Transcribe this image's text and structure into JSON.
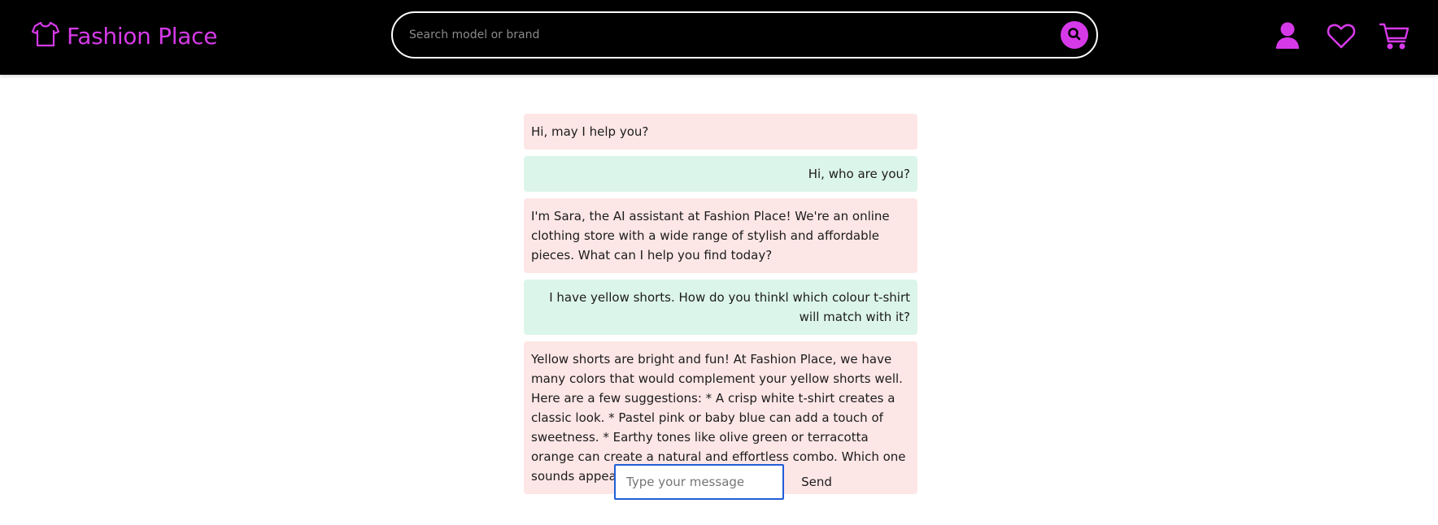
{
  "header": {
    "brand_name": "Fashion Place",
    "brand_icon": "tshirt-icon",
    "search_placeholder": "Search model or brand",
    "search_value": "",
    "icons": [
      "search-icon",
      "user-icon",
      "heart-icon",
      "cart-icon"
    ]
  },
  "colors": {
    "accent": "#d63ae8",
    "header_bg": "#000000",
    "bot_bubble": "#fde6e6",
    "user_bubble": "#dcf5ea",
    "input_border": "#1f5fd8"
  },
  "chat": {
    "messages": [
      {
        "role": "bot",
        "text": "Hi, may I help you?"
      },
      {
        "role": "user",
        "text": "Hi, who are you?"
      },
      {
        "role": "bot",
        "text": "I'm Sara, the AI assistant at Fashion Place! We're an online clothing store with a wide range of stylish and affordable pieces. What can I help you find today?"
      },
      {
        "role": "user",
        "text": "I have yellow shorts. How do you thinkl which colour t-shirt will match with it?"
      },
      {
        "role": "bot",
        "text": "Yellow shorts are bright and fun! At Fashion Place, we have many colors that would complement your yellow shorts well. Here are a few suggestions: * A crisp white t-shirt creates a classic look. * Pastel pink or baby blue can add a touch of sweetness. * Earthy tones like olive green or terracotta orange can create a natural and effortless combo. Which one sounds appealing to you?"
      }
    ],
    "input_placeholder": "Type your message",
    "input_value": "",
    "send_label": "Send"
  }
}
